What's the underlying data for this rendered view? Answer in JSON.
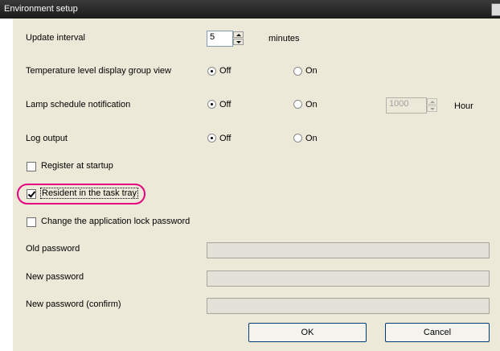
{
  "window": {
    "title": "Environment setup"
  },
  "update_interval": {
    "label": "Update interval",
    "value": "5",
    "unit": "minutes"
  },
  "temperature_display": {
    "label": "Temperature level display group view",
    "off": "Off",
    "on": "On",
    "selected": "Off"
  },
  "lamp_schedule": {
    "label": "Lamp schedule notification",
    "off": "Off",
    "on": "On",
    "selected": "Off",
    "hours_value": "1000",
    "hours_unit": "Hour"
  },
  "log_output": {
    "label": "Log output",
    "off": "Off",
    "on": "On",
    "selected": "Off"
  },
  "register_startup": {
    "label": "Register at startup",
    "checked": false
  },
  "resident_tray": {
    "label": "Resident in the task tray",
    "checked": true
  },
  "change_lock_password": {
    "label": "Change the application lock password",
    "checked": false
  },
  "old_password": {
    "label": "Old password",
    "value": ""
  },
  "new_password": {
    "label": "New password",
    "value": ""
  },
  "new_password_confirm": {
    "label": "New password (confirm)",
    "value": ""
  },
  "buttons": {
    "ok": "OK",
    "cancel": "Cancel"
  },
  "colors": {
    "highlight": "#e4007f",
    "dialog_bg": "#ece9d8",
    "titlebar": "#1a1a1a"
  }
}
